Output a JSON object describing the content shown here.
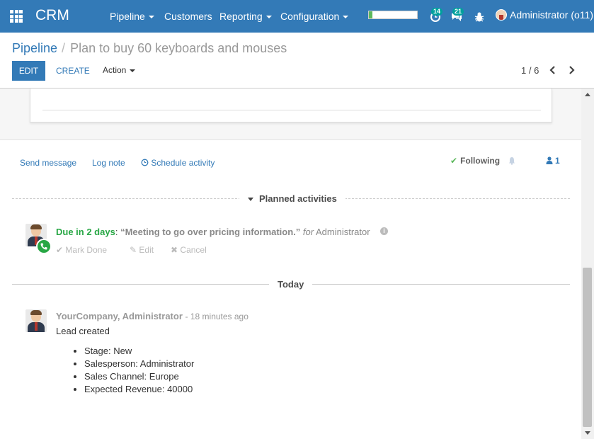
{
  "navbar": {
    "brand": "CRM",
    "menu": [
      {
        "label": "Pipeline",
        "dropdown": true
      },
      {
        "label": "Customers",
        "dropdown": false
      },
      {
        "label": "Reporting",
        "dropdown": true
      },
      {
        "label": "Configuration",
        "dropdown": true
      }
    ],
    "progress_fraction": 0.08,
    "activity_count": "14",
    "message_count": "21",
    "user_name": "Administrator (o11)",
    "icons": [
      "apps-icon",
      "clock-icon",
      "chat-icon",
      "bug-icon"
    ],
    "bar_color": "#337ab7"
  },
  "breadcrumb": {
    "parent": "Pipeline",
    "separator": "/",
    "current": "Plan to buy 60 keyboards and mouses"
  },
  "toolbar": {
    "edit_label": "EDIT",
    "create_label": "CREATE",
    "action_label": "Action"
  },
  "pager": {
    "value": "1 / 6"
  },
  "chatter": {
    "send_message": "Send message",
    "log_note": "Log note",
    "schedule_activity": "Schedule activity",
    "following": "Following",
    "followers_count": "1",
    "planned_label": "Planned activities",
    "activity": {
      "due": "Due in 2 days",
      "colon": ":",
      "summary": "“Meeting to go over pricing information.”",
      "for": "for",
      "user": "Administrator",
      "mark_done": "Mark Done",
      "edit": "Edit",
      "cancel": "Cancel"
    },
    "today_label": "Today",
    "message": {
      "author": "YourCompany, Administrator",
      "date": "- 18 minutes ago",
      "body": "Lead created",
      "tracking": [
        "Stage: New",
        "Salesperson: Administrator",
        "Sales Channel: Europe",
        "Expected Revenue: 40000"
      ]
    }
  },
  "colors": {
    "accent": "#337ab7",
    "due_green": "#28a745"
  }
}
